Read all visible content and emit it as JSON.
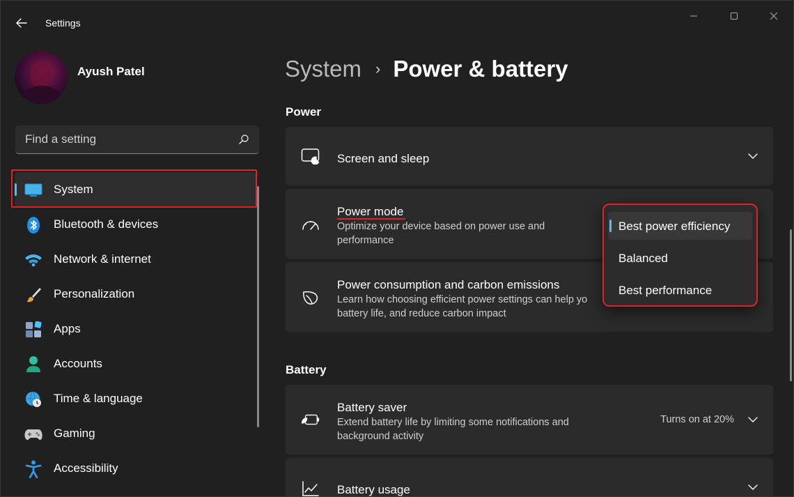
{
  "window": {
    "app_title": "Settings",
    "back_icon": "arrow-left-icon",
    "controls": [
      "minimize-icon",
      "maximize-icon",
      "close-icon"
    ]
  },
  "profile": {
    "name": "Ayush Patel"
  },
  "search": {
    "placeholder": "Find a setting",
    "icon": "search-icon"
  },
  "sidebar": {
    "items": [
      {
        "label": "System",
        "icon": "monitor-icon",
        "active": true
      },
      {
        "label": "Bluetooth & devices",
        "icon": "bluetooth-icon"
      },
      {
        "label": "Network & internet",
        "icon": "wifi-icon"
      },
      {
        "label": "Personalization",
        "icon": "brush-icon"
      },
      {
        "label": "Apps",
        "icon": "apps-icon"
      },
      {
        "label": "Accounts",
        "icon": "person-icon"
      },
      {
        "label": "Time & language",
        "icon": "globe-clock-icon"
      },
      {
        "label": "Gaming",
        "icon": "gamepad-icon"
      },
      {
        "label": "Accessibility",
        "icon": "accessibility-icon"
      }
    ]
  },
  "breadcrumb": {
    "parent": "System",
    "separator": "›",
    "current": "Power & battery"
  },
  "power": {
    "section_title": "Power",
    "screen_sleep": {
      "title": "Screen and sleep",
      "icon": "screen-sleep-icon"
    },
    "power_mode": {
      "title": "Power mode",
      "description": "Optimize your device based on power use and performance",
      "icon": "speedometer-icon"
    },
    "consumption": {
      "title": "Power consumption and carbon emissions",
      "description": "Learn how choosing efficient power settings can help yo… battery life, and reduce carbon impact",
      "desc_line1": "Learn how choosing efficient power settings can help yo",
      "desc_line2": "battery life, and reduce carbon impact",
      "icon": "leaf-icon"
    }
  },
  "power_mode_dropdown": {
    "options": [
      "Best power efficiency",
      "Balanced",
      "Best performance"
    ],
    "selected": "Best power efficiency"
  },
  "battery": {
    "section_title": "Battery",
    "saver": {
      "title": "Battery saver",
      "description": "Extend battery life by limiting some notifications and background activity",
      "status": "Turns on at 20%",
      "icon": "battery-leaf-icon"
    },
    "usage": {
      "title": "Battery usage",
      "icon": "chart-line-icon"
    }
  },
  "colors": {
    "accent": "#4cc2ff",
    "highlight_red": "#e0202a",
    "background": "#202020",
    "card": "#2b2b2b"
  }
}
